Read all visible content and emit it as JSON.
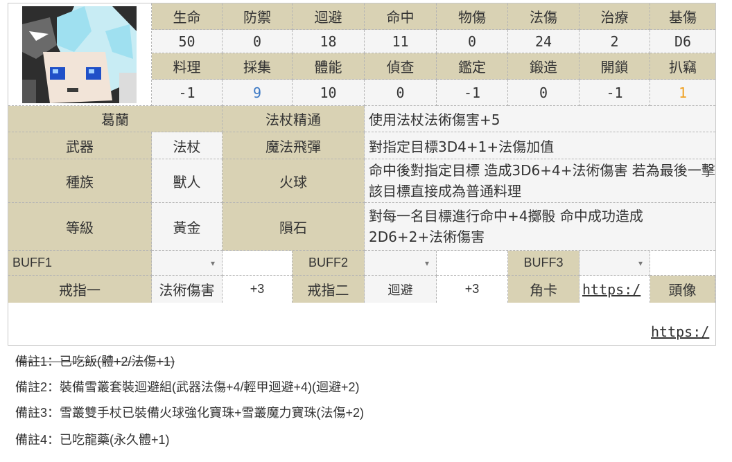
{
  "stats_row1": {
    "labels": [
      "生命",
      "防禦",
      "迴避",
      "命中",
      "物傷",
      "法傷",
      "治療",
      "基傷"
    ],
    "values": [
      "50",
      "0",
      "18",
      "11",
      "0",
      "24",
      "2",
      "D6"
    ]
  },
  "stats_row2": {
    "labels": [
      "料理",
      "採集",
      "體能",
      "偵查",
      "鑑定",
      "鍛造",
      "開鎖",
      "扒竊"
    ],
    "values": [
      "-1",
      "9",
      "10",
      "0",
      "-1",
      "0",
      "-1",
      "1"
    ]
  },
  "colors": {
    "label_bg": "#d9d2b4",
    "value_bg": "#f5f5f5",
    "highlight_blue": "#3b78c4",
    "highlight_orange": "#f0a020"
  },
  "character": {
    "name": "葛蘭"
  },
  "info": [
    {
      "label": "武器",
      "value": "法杖"
    },
    {
      "label": "種族",
      "value": "獸人"
    },
    {
      "label": "等級",
      "value": "黃金"
    }
  ],
  "skills": [
    {
      "name": "法杖精通",
      "desc": "使用法杖法術傷害+5"
    },
    {
      "name": "魔法飛彈",
      "desc": "對指定目標3D4+1+法傷加值"
    },
    {
      "name": "火球",
      "desc": "命中後對指定目標 造成3D6+4+法術傷害 若為最後一擊 該目標直接成為普通料理"
    },
    {
      "name": "隕石",
      "desc": "對每一名目標進行命中+4擲骰 命中成功造成2D6+2+法術傷害"
    }
  ],
  "buffs": [
    {
      "label": "BUFF1",
      "caret": "▾"
    },
    {
      "label": "BUFF2",
      "caret": "▾"
    },
    {
      "label": "BUFF3",
      "caret": "▾"
    }
  ],
  "rings": [
    {
      "label": "戒指一",
      "stat": "法術傷害",
      "bonus": "+3"
    },
    {
      "label": "戒指二",
      "stat": "迴避",
      "bonus": "+3"
    }
  ],
  "card": {
    "label": "角卡",
    "link": "https:/"
  },
  "avatar_link": {
    "label": "頭像",
    "link": "https:/"
  },
  "notes": [
    "備註1：已吃飯(體+2/法傷+1)",
    "備註2：裝備雪叢套裝迴避組(武器法傷+4/輕甲迴避+4)(迴避+2)",
    "備註3：雪叢雙手杖已裝備火球強化寶珠+雪叢魔力寶珠(法傷+2)",
    "備註4：已吃龍藥(永久體+1)"
  ]
}
